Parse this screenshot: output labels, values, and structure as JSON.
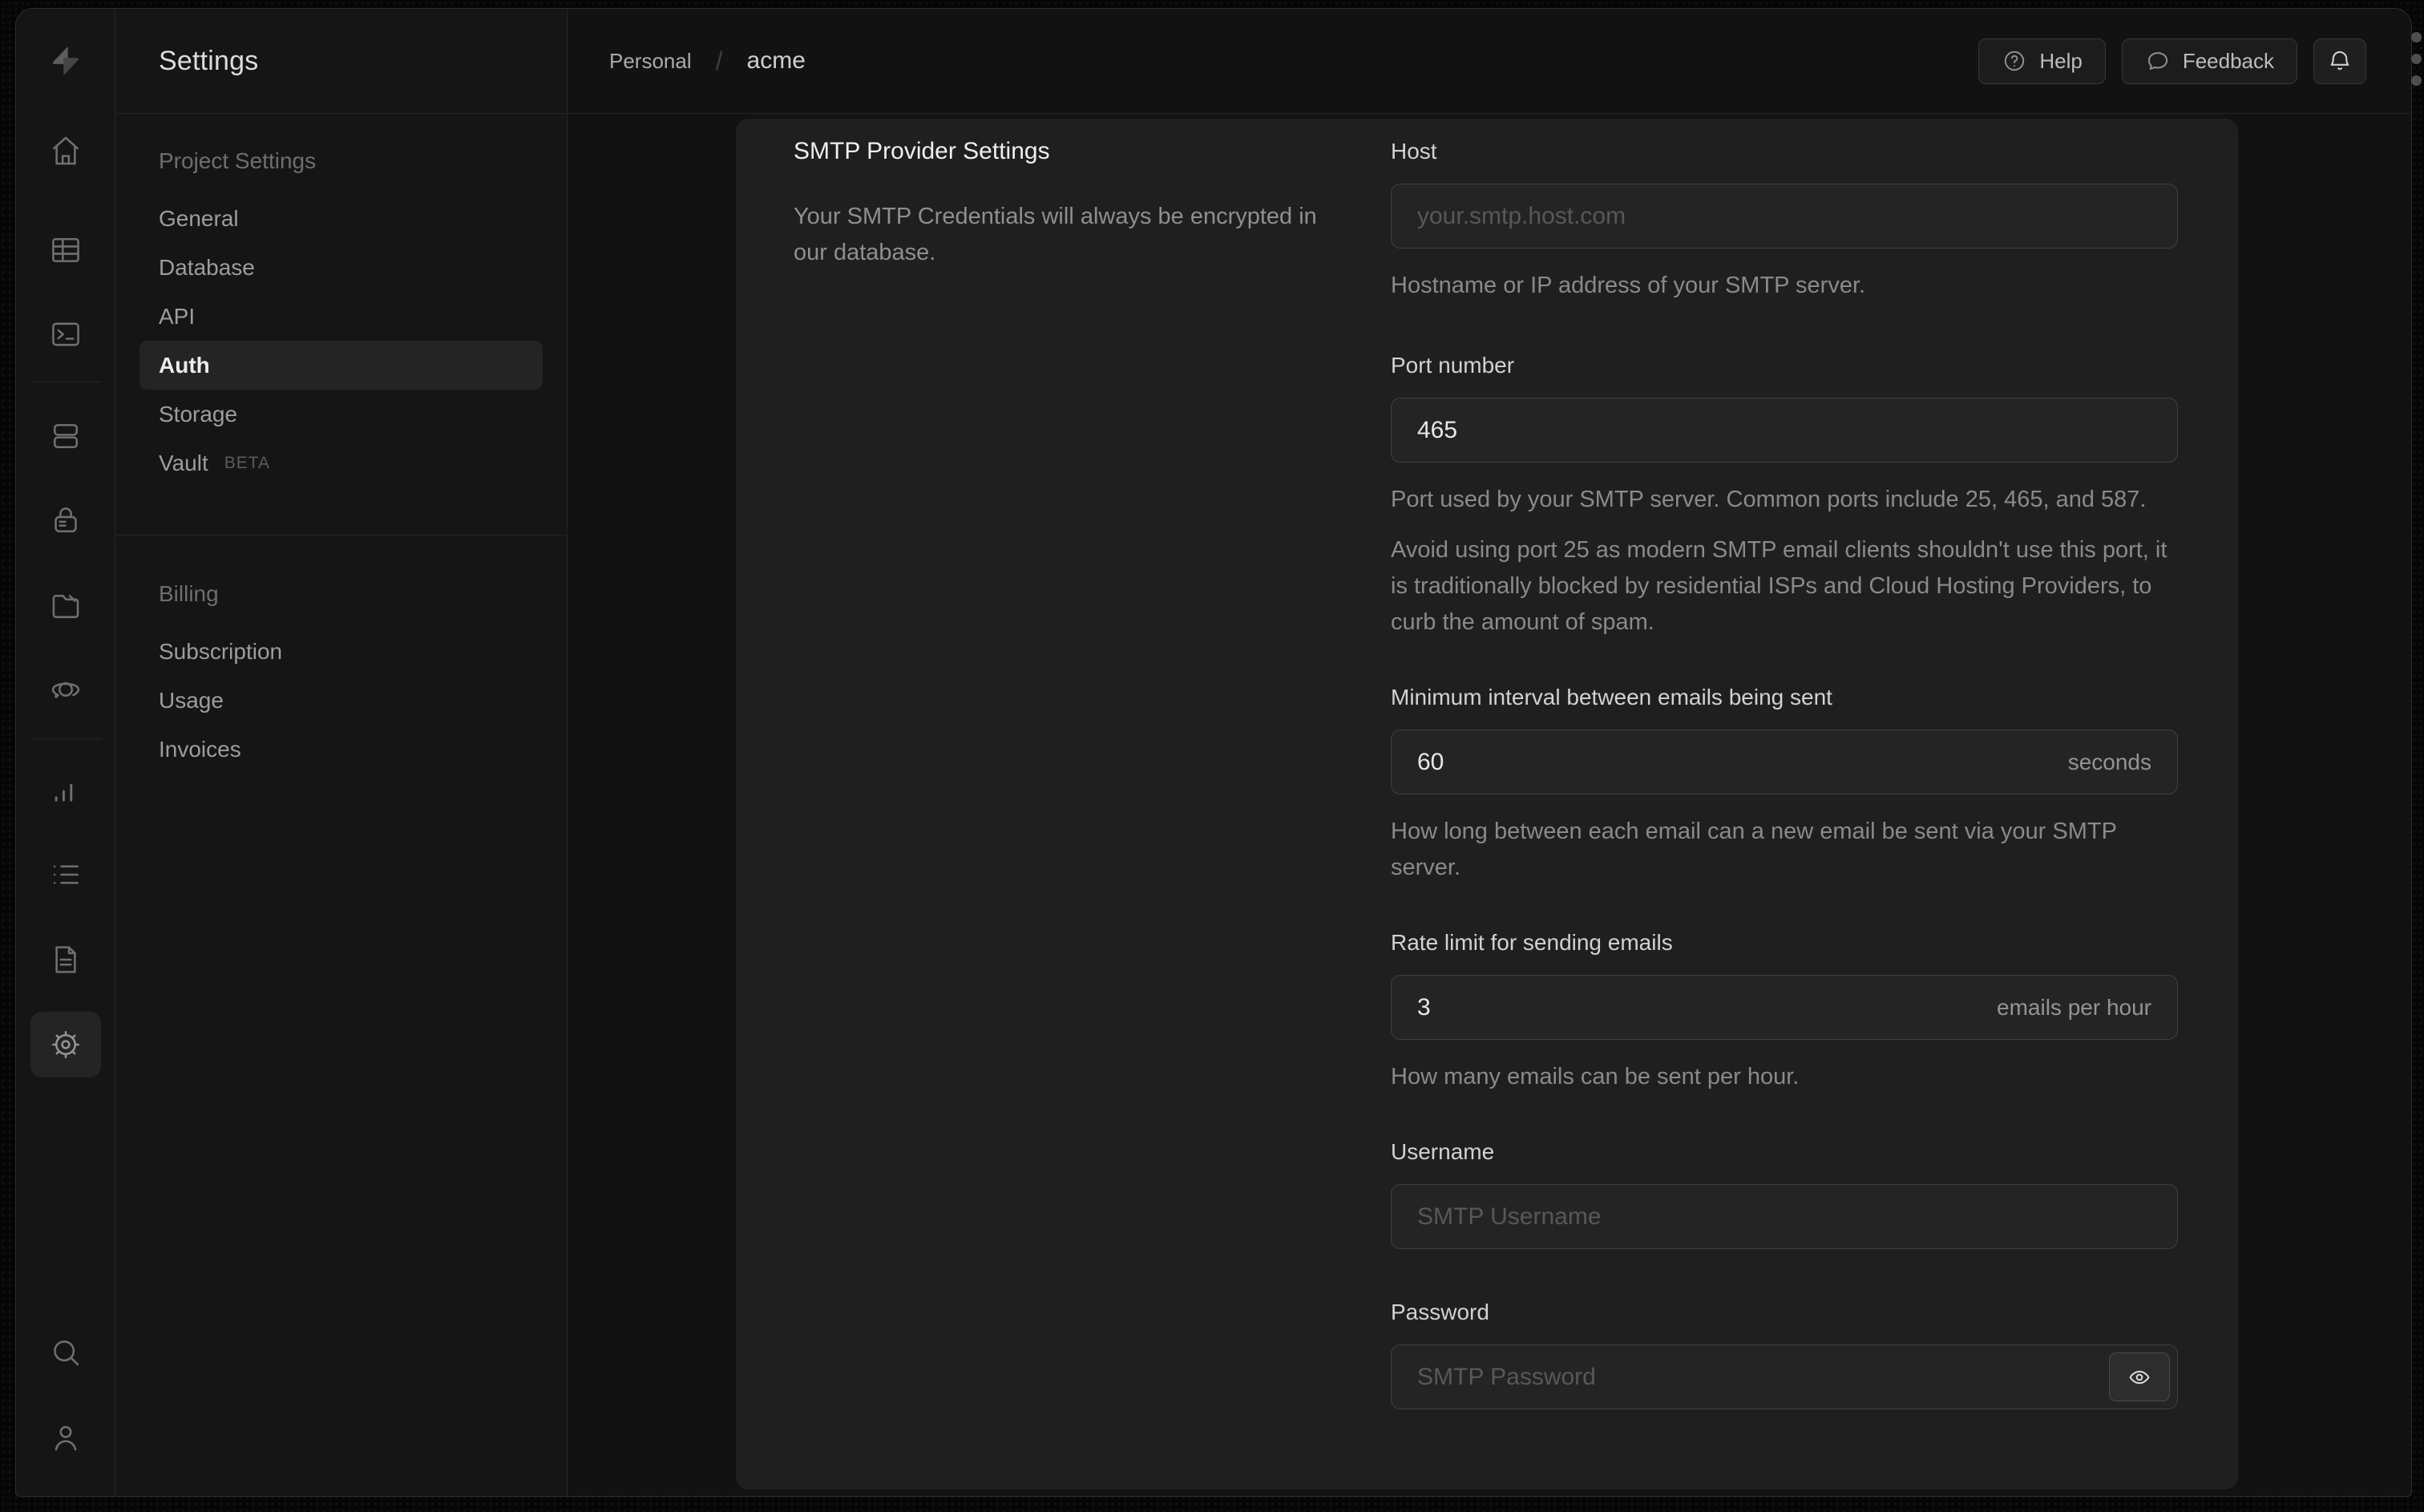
{
  "rail": {
    "icons": [
      "supabase-logo",
      "home",
      "table-editor",
      "sql-editor",
      "database",
      "auth",
      "storage",
      "edge-functions",
      "reports",
      "logs",
      "api-docs",
      "settings",
      "search",
      "account"
    ]
  },
  "sidebar": {
    "title": "Settings",
    "sections": [
      {
        "label": "Project Settings",
        "items": [
          {
            "label": "General"
          },
          {
            "label": "Database"
          },
          {
            "label": "API"
          },
          {
            "label": "Auth",
            "selected": true
          },
          {
            "label": "Storage"
          },
          {
            "label": "Vault",
            "badge": "BETA"
          }
        ]
      },
      {
        "label": "Billing",
        "items": [
          {
            "label": "Subscription"
          },
          {
            "label": "Usage"
          },
          {
            "label": "Invoices"
          }
        ]
      }
    ]
  },
  "header": {
    "breadcrumb": {
      "org": "Personal",
      "separator": "/",
      "project": "acme"
    },
    "help_label": "Help",
    "feedback_label": "Feedback"
  },
  "panel": {
    "title": "SMTP Provider Settings",
    "description": "Your SMTP Credentials will always be encrypted in our database.",
    "fields": {
      "host": {
        "label": "Host",
        "placeholder": "your.smtp.host.com",
        "help": "Hostname or IP address of your SMTP server."
      },
      "port": {
        "label": "Port number",
        "value": "465",
        "help": "Port used by your SMTP server. Common ports include 25, 465, and 587.",
        "note": "Avoid using port 25 as modern SMTP email clients shouldn't use this port, it is traditionally blocked by residential ISPs and Cloud Hosting Providers, to curb the amount of spam."
      },
      "interval": {
        "label": "Minimum interval between emails being sent",
        "value": "60",
        "unit": "seconds",
        "help": "How long between each email can a new email be sent via your SMTP server."
      },
      "rate_limit": {
        "label": "Rate limit for sending emails",
        "value": "3",
        "unit": "emails per hour",
        "help": "How many emails can be sent per hour."
      },
      "username": {
        "label": "Username",
        "placeholder": "SMTP Username"
      },
      "password": {
        "label": "Password",
        "placeholder": "SMTP Password"
      }
    }
  },
  "colors": {
    "panel_bg": "#1f1f1f",
    "window_bg": "#121212",
    "border": "#252525",
    "selected_text": "#ececec",
    "input_border": "#414141"
  }
}
